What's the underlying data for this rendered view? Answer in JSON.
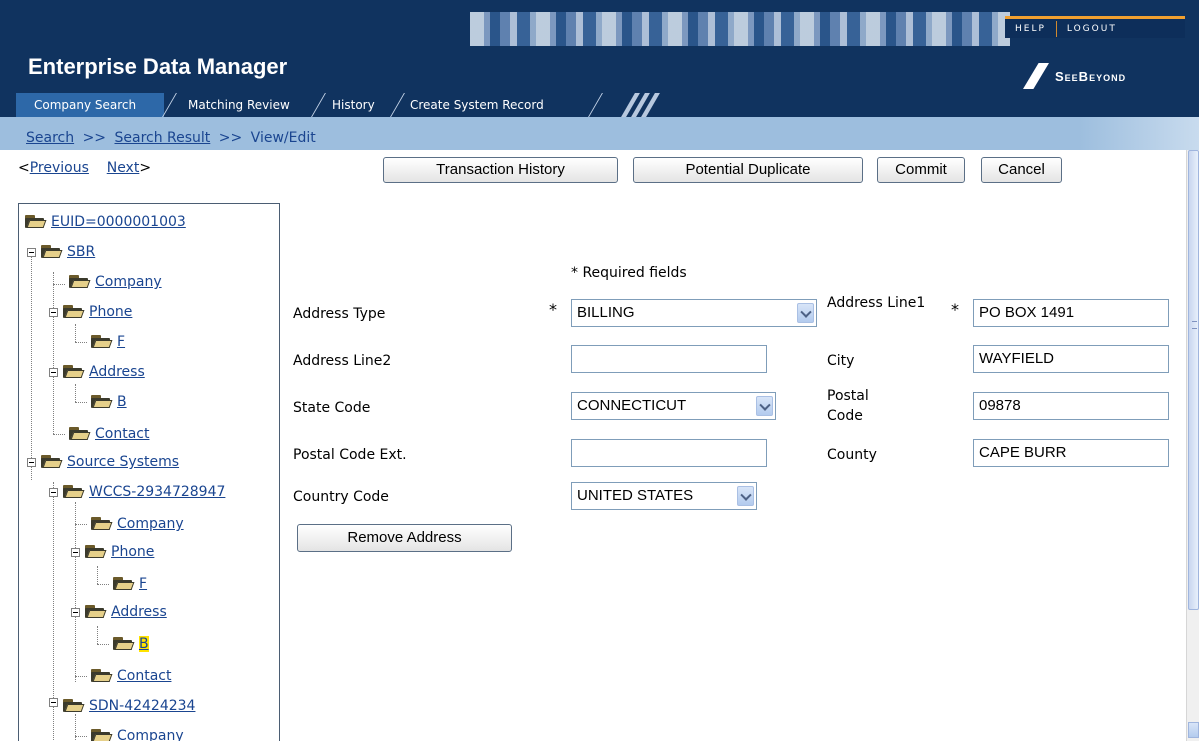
{
  "header": {
    "title": "Enterprise Data Manager",
    "help": "HELP",
    "logout": "LOGOUT",
    "logo_text": "SeeBeyond"
  },
  "tabs": [
    {
      "label": "Company Search",
      "active": true
    },
    {
      "label": "Matching Review",
      "active": false
    },
    {
      "label": "History",
      "active": false
    },
    {
      "label": "Create System Record",
      "active": false
    }
  ],
  "breadcrumb": {
    "search": "Search",
    "separator": ">>",
    "search_result": "Search Result",
    "current": "View/Edit"
  },
  "nav": {
    "previous": "Previous",
    "next": "Next"
  },
  "toolbar": {
    "transaction_history": "Transaction History",
    "potential_duplicate": "Potential Duplicate",
    "commit": "Commit",
    "cancel": "Cancel"
  },
  "tree": {
    "euid": "EUID=0000001003",
    "sbr": "SBR",
    "sbr_company": "Company",
    "sbr_phone": "Phone",
    "sbr_phone_f": "F",
    "sbr_address": "Address",
    "sbr_address_b": "B",
    "sbr_contact": "Contact",
    "source_systems": "Source Systems",
    "wccs": "WCCS-2934728947",
    "wccs_company": "Company",
    "wccs_phone": "Phone",
    "wccs_phone_f": "F",
    "wccs_address": "Address",
    "wccs_address_b": "B",
    "wccs_contact": "Contact",
    "sdn": "SDN-42424234",
    "sdn_company": "Company"
  },
  "form": {
    "required_note": "* Required fields",
    "required_marker": "*",
    "address_type_label": "Address Type",
    "address_type_value": "BILLING",
    "address_line1_label": "Address Line1",
    "address_line1_value": "PO BOX 1491",
    "address_line2_label": "Address Line2",
    "address_line2_value": "",
    "city_label": "City",
    "city_value": "WAYFIELD",
    "state_code_label": "State Code",
    "state_code_value": "CONNECTICUT",
    "postal_code_label": "Postal Code",
    "postal_code_value": "09878",
    "postal_code_ext_label": "Postal Code Ext.",
    "postal_code_ext_value": "",
    "county_label": "County",
    "county_value": "CAPE BURR",
    "country_code_label": "Country Code",
    "country_code_value": "UNITED STATES",
    "remove_address": "Remove Address"
  }
}
